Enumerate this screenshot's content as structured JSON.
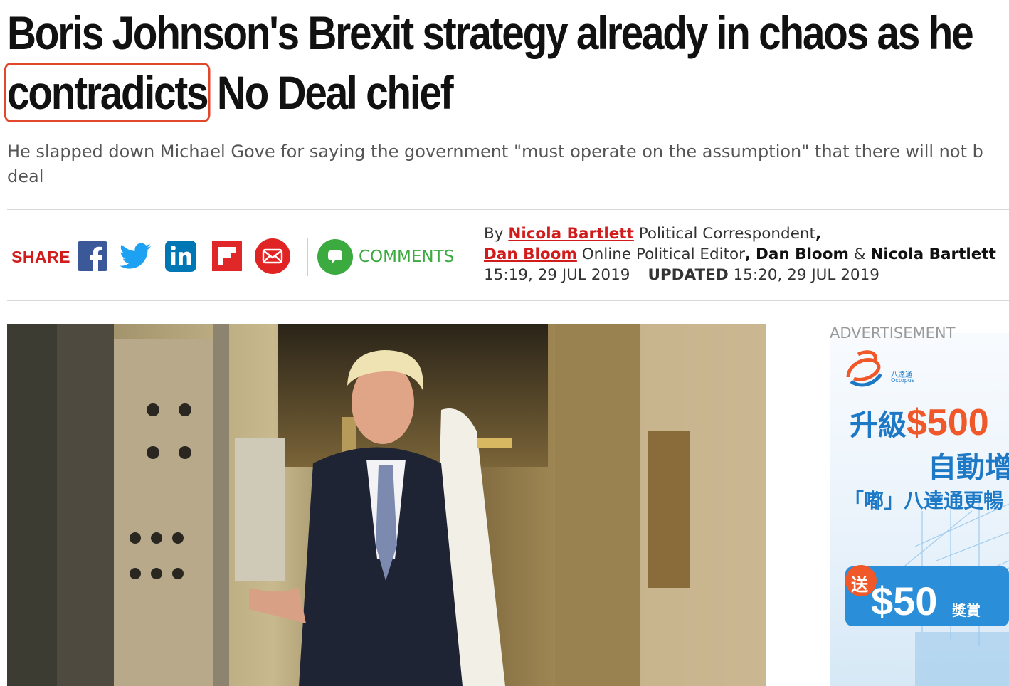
{
  "article": {
    "headline_before": "Boris Johnson's Brexit strategy already in chaos as he",
    "headline_highlight": "contradicts",
    "headline_after": " No Deal chief",
    "standfirst_line1": "He slapped down Michael Gove for saying the government \"must operate on the assumption\" that there will not b",
    "standfirst_line2": "deal"
  },
  "share": {
    "label": "SHARE",
    "icons": [
      "facebook-icon",
      "twitter-icon",
      "linkedin-icon",
      "flipboard-icon",
      "email-icon"
    ],
    "comments_label": "COMMENTS"
  },
  "byline": {
    "by": "By",
    "author1": "Nicola Bartlett",
    "author1_role": " Political Correspondent",
    "comma": ",",
    "author2": "Dan Bloom",
    "author2_role": " Online Political Editor",
    "comma2": ",",
    "credit1": "Dan Bloom",
    "amp": " & ",
    "credit2": "Nicola Bartlett",
    "published": "15:19, 29 JUL 2019",
    "updated_label": "UPDATED",
    "updated": " 15:20, 29 JUL 2019"
  },
  "ad": {
    "label": "ADVERTISEMENT",
    "brand": "八達通",
    "brand_en": "Octopus",
    "line1_prefix": "升級",
    "line1_amount": "$500",
    "line2": "自動增",
    "line3": "「嘟」八達通更暢",
    "badge": "送",
    "reward_amount": "$50",
    "reward_label": "獎賞"
  },
  "colors": {
    "accent_red": "#d21c1c",
    "highlight_box": "#e0472b",
    "comments_green": "#3bab3f",
    "facebook": "#3b5998",
    "twitter": "#1da1f2",
    "linkedin": "#0077b5",
    "flipboard": "#e12828",
    "email": "#e02424",
    "ad_orange": "#f0582a",
    "ad_blue": "#1d79c6"
  }
}
